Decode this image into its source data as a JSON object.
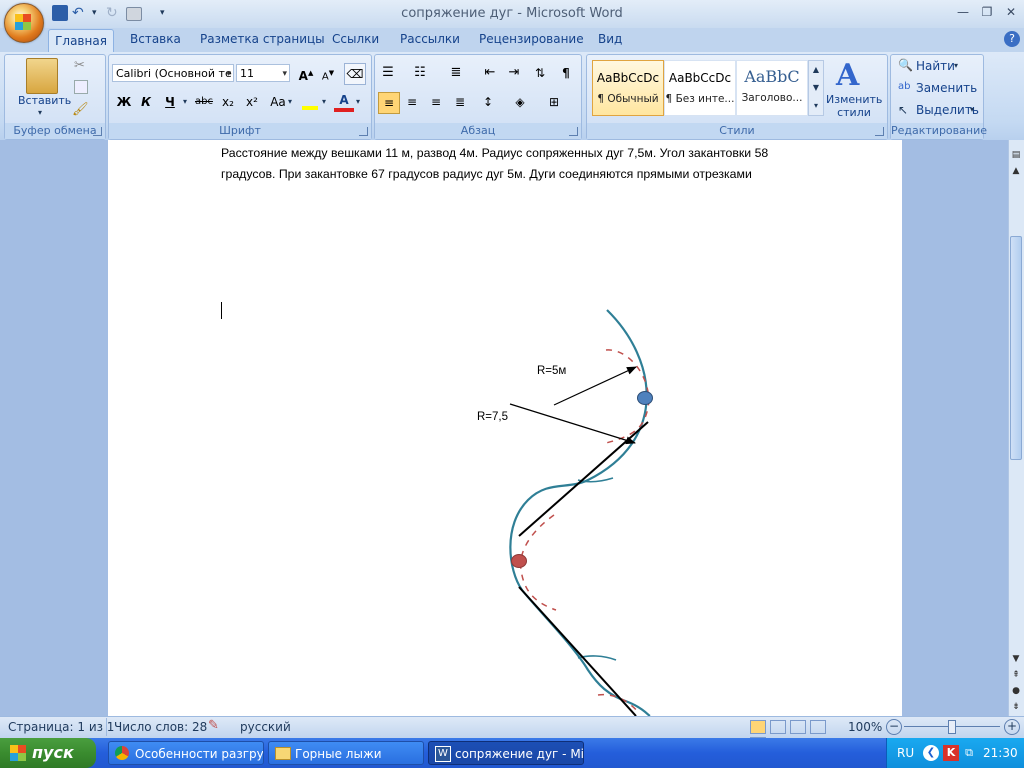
{
  "window": {
    "title": "сопряжение дуг - Microsoft Word"
  },
  "tabs": [
    "Главная",
    "Вставка",
    "Разметка страницы",
    "Ссылки",
    "Рассылки",
    "Рецензирование",
    "Вид"
  ],
  "ribbon": {
    "clipboard": {
      "label": "Буфер обмена",
      "paste": "Вставить"
    },
    "font": {
      "label": "Шрифт",
      "family": "Calibri (Основной те",
      "size": "11",
      "bold": "Ж",
      "italic": "К",
      "underline": "Ч",
      "strike": "abc",
      "sub": "x₂",
      "sup": "x²",
      "case": "Aa"
    },
    "paragraph": {
      "label": "Абзац"
    },
    "styles": {
      "label": "Стили",
      "items": [
        {
          "preview": "AaBbCcDc",
          "name": "¶ Обычный"
        },
        {
          "preview": "AaBbCcDc",
          "name": "¶ Без инте..."
        },
        {
          "preview": "AaBbC",
          "name": "Заголово..."
        }
      ],
      "change": "Изменить стили"
    },
    "editing": {
      "label": "Редактирование",
      "find": "Найти",
      "replace": "Заменить",
      "select": "Выделить"
    }
  },
  "document": {
    "line1": "Расстояние между вешками 11 м, развод 4м. Радиус сопряженных дуг 7,5м. Угол закантовки 58",
    "line2": "градусов. При закантовке 67 градусов  радиус дуг 5м. Дуги соединяются прямыми отрезками",
    "label_r5": "R=5м",
    "label_r75": "R=7,5"
  },
  "status": {
    "page": "Страница: 1 из 1",
    "words": "Число слов: 28",
    "lang": "русский",
    "zoom": "100%"
  },
  "taskbar": {
    "start": "пуск",
    "items": [
      "Особенности разгру...",
      "Горные лыжи",
      "сопряжение дуг - Mi..."
    ],
    "lang": "RU",
    "time": "21:30"
  },
  "colors": {
    "arc": "#2f7f96",
    "dashed": "#c0504d",
    "blue_dot": "#4f81bd",
    "red_dot": "#c0504d"
  }
}
